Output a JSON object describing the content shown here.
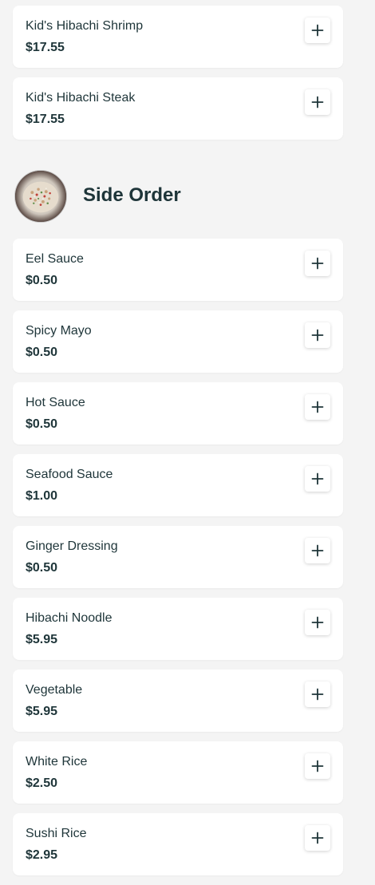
{
  "kids_section": {
    "items": [
      {
        "name": "Kid's Hibachi Shrimp",
        "price": "$17.55"
      },
      {
        "name": "Kid's Hibachi Steak",
        "price": "$17.55"
      }
    ]
  },
  "side_order": {
    "title": "Side Order",
    "image_icon": "fried-rice-photo",
    "items": [
      {
        "name": "Eel Sauce",
        "price": "$0.50"
      },
      {
        "name": "Spicy Mayo",
        "price": "$0.50"
      },
      {
        "name": "Hot Sauce",
        "price": "$0.50"
      },
      {
        "name": "Seafood Sauce",
        "price": "$1.00"
      },
      {
        "name": "Ginger Dressing",
        "price": "$0.50"
      },
      {
        "name": "Hibachi Noodle",
        "price": "$5.95"
      },
      {
        "name": "Vegetable",
        "price": "$5.95"
      },
      {
        "name": "White Rice",
        "price": "$2.50"
      },
      {
        "name": "Sushi Rice",
        "price": "$2.95"
      }
    ]
  },
  "add_button_icon": "plus-icon",
  "colors": {
    "background": "#f4f4f4",
    "card": "#ffffff",
    "text": "#1e3539"
  }
}
